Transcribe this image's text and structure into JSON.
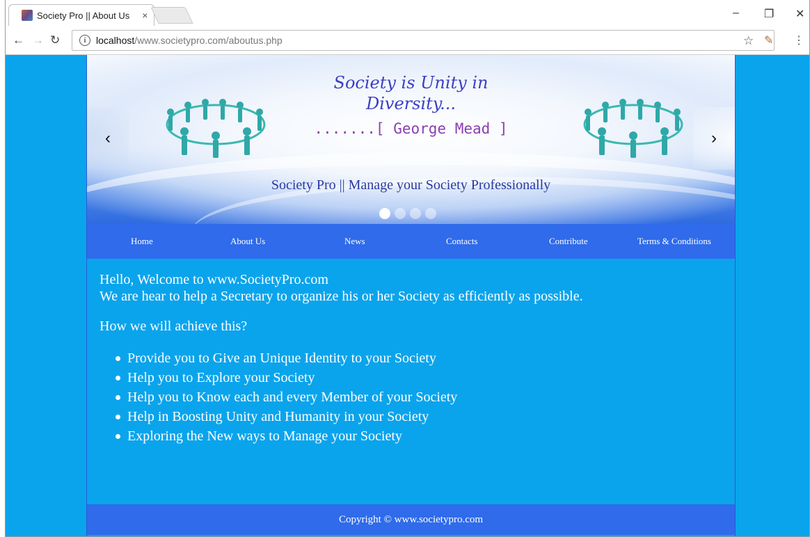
{
  "browser": {
    "tab_title": "Society Pro || About Us",
    "tab_close": "×",
    "url_host": "localhost",
    "url_path": "/www.societypro.com/aboutus.php"
  },
  "banner": {
    "quote_line1": "Society is Unity in",
    "quote_line2": "Diversity...",
    "author": ".......[ George Mead ]",
    "tagline": "Society Pro || Manage your Society Professionally",
    "prev_arrow": "‹",
    "next_arrow": "›",
    "slide_count": 4,
    "active_slide": 1
  },
  "nav": {
    "items": [
      "Home",
      "About Us",
      "News",
      "Contacts",
      "Contribute",
      "Terms & Conditions"
    ]
  },
  "content": {
    "welcome": "Hello, Welcome to www.SocietyPro.com",
    "intro": "We are hear to help a Secretary to organize his or her Society as efficiently as possible.",
    "how": "How we will achieve this?",
    "points": [
      "Provide you to Give an Unique Identity to your Society",
      "Help you to Explore your Society",
      "Help you to Know each and every Member of your Society",
      "Help in Boosting Unity and Humanity in your Society",
      "Exploring the New ways to Manage your Society"
    ]
  },
  "footer": {
    "copyright": "Copyright © www.societypro.com"
  },
  "colors": {
    "page_bg": "#0aa4ec",
    "nav_bg": "#2f6bea",
    "quote": "#3b3fc4",
    "author": "#8a3fb0"
  }
}
